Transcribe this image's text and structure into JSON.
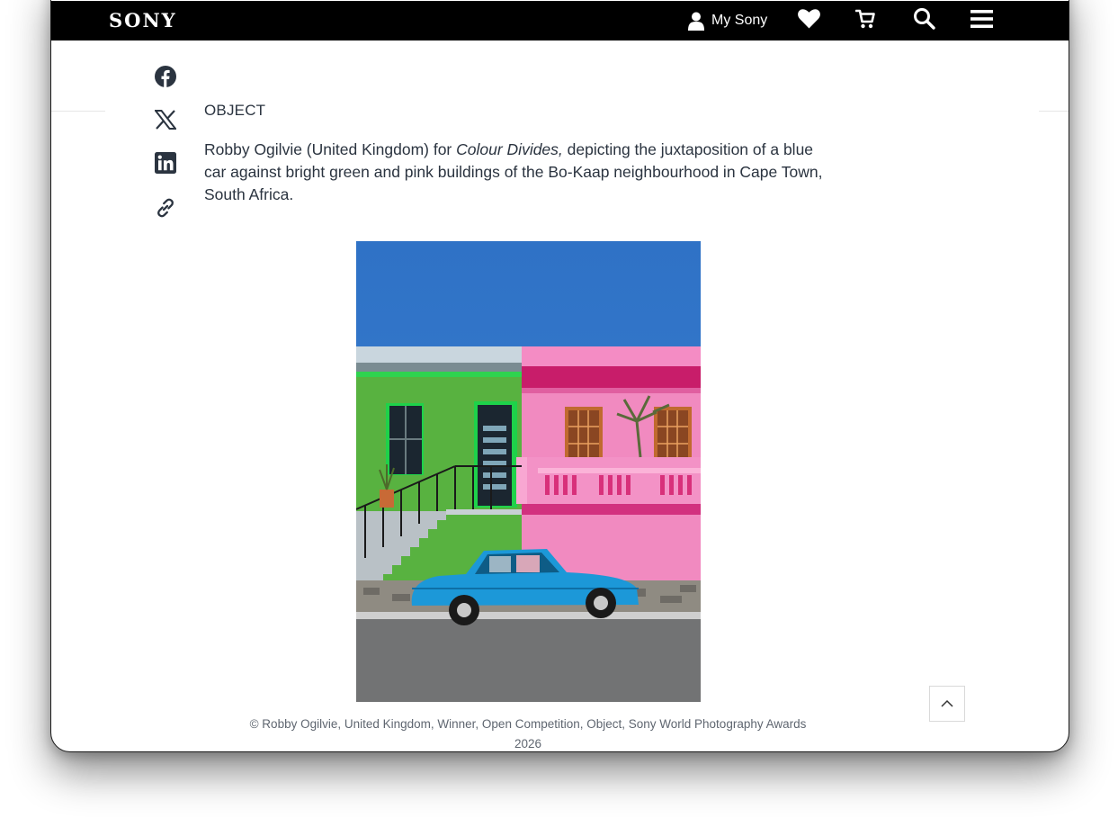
{
  "header": {
    "logo": "SONY",
    "account_label": "My Sony",
    "icons": [
      "user-icon",
      "heart-icon",
      "cart-icon",
      "search-icon",
      "menu-icon"
    ]
  },
  "share": {
    "icons": [
      "facebook-icon",
      "x-icon",
      "linkedin-icon",
      "link-icon"
    ]
  },
  "article": {
    "category": "OBJECT",
    "caption_before": "Robby Ogilvie (United Kingdom) for ",
    "caption_title": "Colour Divides,",
    "caption_after": " depicting the juxtaposition of a blue car against bright green and pink buildings of the Bo-Kaap neighbourhood in Cape Town, South Africa.",
    "credit_line1": "© Robby Ogilvie, United Kingdom, Winner, Open Competition, Object, Sony World Photography Awards",
    "credit_line2": "2026"
  },
  "colors": {
    "header_bg": "#000000",
    "text": "#2b3440"
  }
}
